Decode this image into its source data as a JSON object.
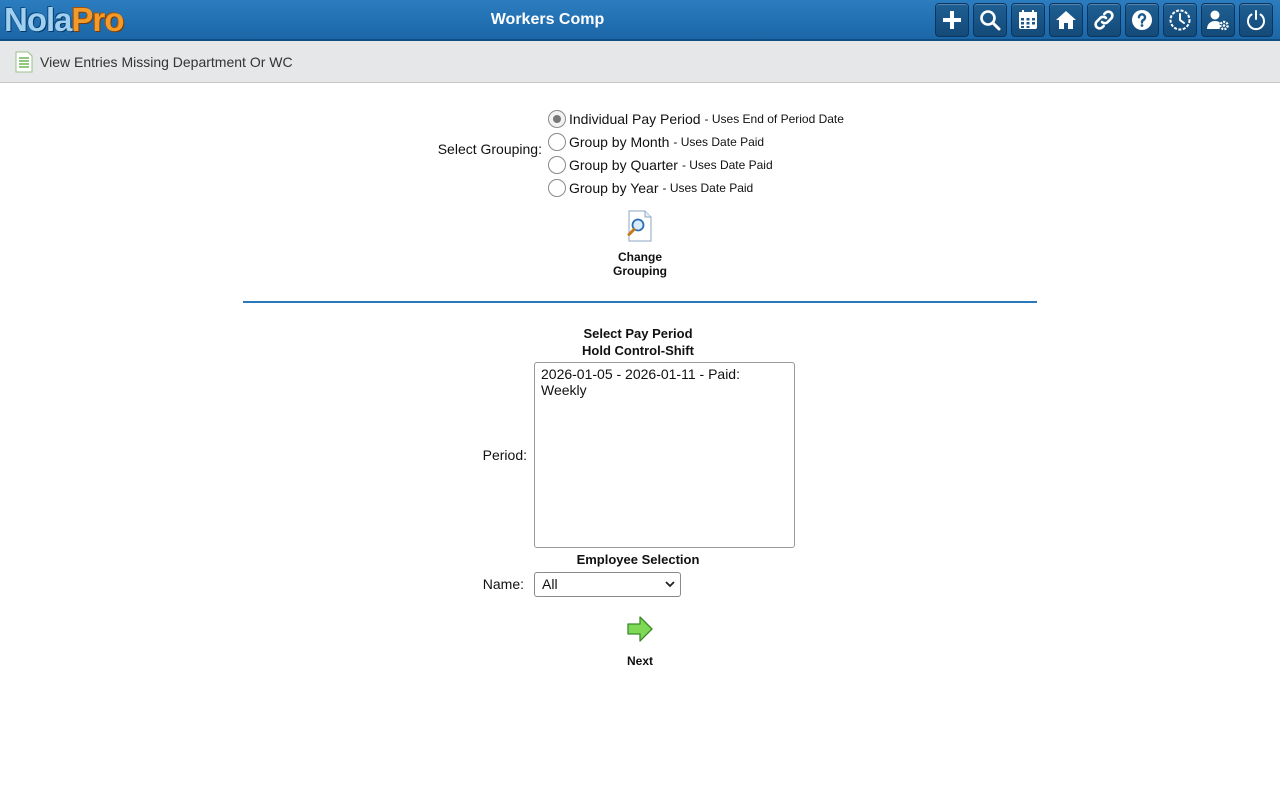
{
  "header": {
    "logo_part1": "Nola",
    "logo_part2": "Pro",
    "title": "Workers Comp",
    "icons": [
      "plus-icon",
      "search-icon",
      "calendar-icon",
      "home-icon",
      "link-icon",
      "help-icon",
      "clock-icon",
      "user-settings-icon",
      "power-icon"
    ]
  },
  "toolbar": {
    "report_link": "View Entries Missing Department Or WC"
  },
  "grouping": {
    "label": "Select Grouping:",
    "options": [
      {
        "label": "Individual Pay Period",
        "note": "- Uses End of Period Date",
        "selected": true
      },
      {
        "label": "Group by Month",
        "note": "- Uses Date Paid",
        "selected": false
      },
      {
        "label": "Group by Quarter",
        "note": "- Uses Date Paid",
        "selected": false
      },
      {
        "label": "Group by Year",
        "note": "- Uses Date Paid",
        "selected": false
      }
    ],
    "change_line1": "Change",
    "change_line2": "Grouping"
  },
  "period": {
    "heading1": "Select Pay Period",
    "heading2": "Hold Control-Shift",
    "label": "Period:",
    "items": [
      "2026-01-05 - 2026-01-11 - Paid: Weekly"
    ]
  },
  "employee": {
    "heading": "Employee Selection",
    "label": "Name:",
    "selected": "All"
  },
  "actions": {
    "next_label": "Next"
  }
}
